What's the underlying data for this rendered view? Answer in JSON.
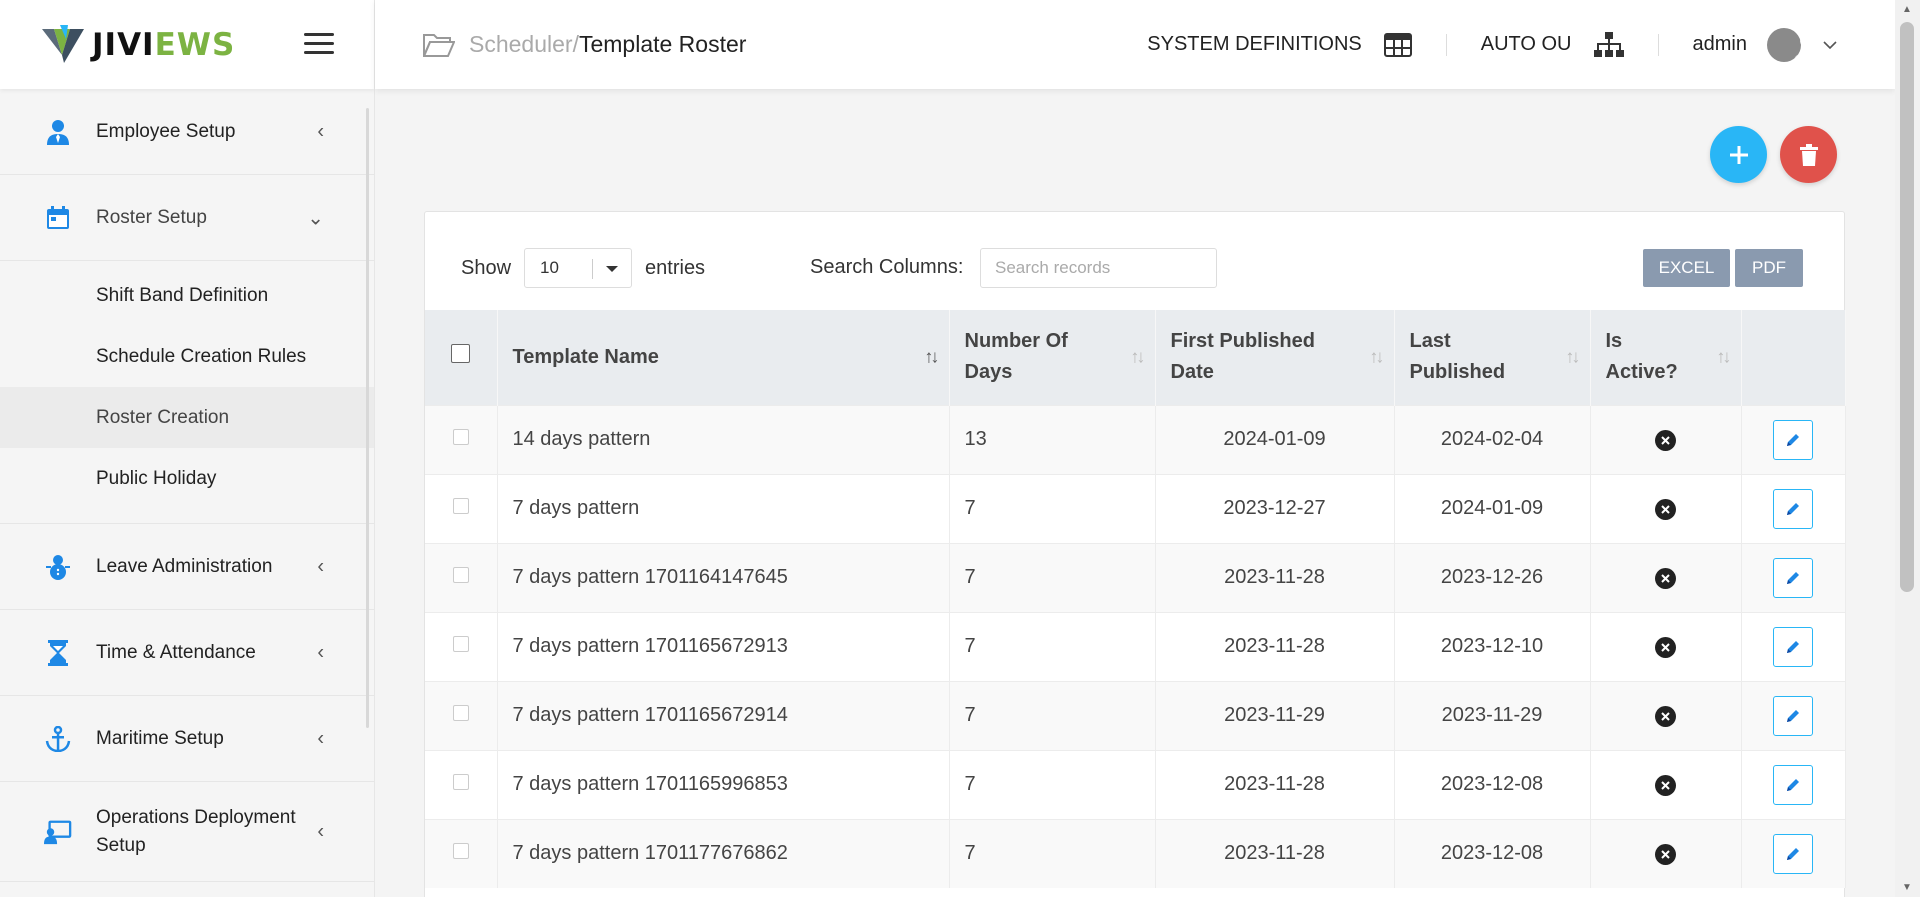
{
  "brand": {
    "part1": "JIVI",
    "part2": "EWS"
  },
  "sidebar": {
    "items": [
      {
        "label": "Employee Setup",
        "icon": "person-tie-icon",
        "chevron": "‹"
      },
      {
        "label": "Roster Setup",
        "icon": "calendar-icon",
        "chevron": "⌄"
      },
      {
        "label": "Leave Administration",
        "icon": "snowman-icon",
        "chevron": "‹"
      },
      {
        "label": "Time & Attendance",
        "icon": "hourglass-icon",
        "chevron": "‹"
      },
      {
        "label": "Maritime Setup",
        "icon": "anchor-icon",
        "chevron": "‹"
      },
      {
        "label": "Operations Deployment Setup",
        "icon": "monitor-user-icon",
        "chevron": "‹"
      }
    ],
    "roster_sub": [
      {
        "label": "Shift Band Definition"
      },
      {
        "label": "Schedule Creation Rules"
      },
      {
        "label": "Roster Creation"
      },
      {
        "label": "Public Holiday"
      }
    ]
  },
  "breadcrumb": {
    "parent": "Scheduler/",
    "current": "Template Roster"
  },
  "topnav": {
    "system_definitions": "SYSTEM DEFINITIONS",
    "auto_ou": "AUTO OU",
    "user": "admin"
  },
  "controls": {
    "show": "Show",
    "entries_value": "10",
    "entries": "entries",
    "search_label": "Search Columns:",
    "search_placeholder": "Search records",
    "excel": "EXCEL",
    "pdf": "PDF"
  },
  "table": {
    "headers": {
      "name": "Template Name",
      "days": "Number Of Days",
      "first": "First Published Date",
      "last": "Last Published",
      "active": "Is Active?"
    },
    "rows": [
      {
        "name": "14 days pattern",
        "days": "13",
        "first": "2024-01-09",
        "last": "2024-02-04"
      },
      {
        "name": "7 days pattern",
        "days": "7",
        "first": "2023-12-27",
        "last": "2024-01-09"
      },
      {
        "name": "7 days pattern 1701164147645",
        "days": "7",
        "first": "2023-11-28",
        "last": "2023-12-26"
      },
      {
        "name": "7 days pattern 1701165672913",
        "days": "7",
        "first": "2023-11-28",
        "last": "2023-12-10"
      },
      {
        "name": "7 days pattern 1701165672914",
        "days": "7",
        "first": "2023-11-29",
        "last": "2023-11-29"
      },
      {
        "name": "7 days pattern 1701165996853",
        "days": "7",
        "first": "2023-11-28",
        "last": "2023-12-08"
      },
      {
        "name": "7 days pattern 1701177676862",
        "days": "7",
        "first": "2023-11-28",
        "last": "2023-12-08"
      }
    ]
  },
  "colors": {
    "accent": "#29b6f6",
    "danger": "#e0524b",
    "brand_green": "#7cb342",
    "export_btn": "#8a9aaf"
  }
}
